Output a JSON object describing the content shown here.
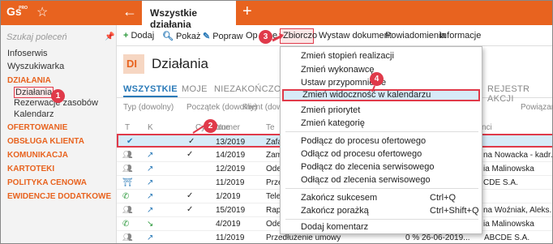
{
  "app": {
    "logo": "Gs",
    "logo_tag": "PRO",
    "tab_title": "Wszystkie działania"
  },
  "sidebar": {
    "search_placeholder": "Szukaj poleceń",
    "items": [
      "Infoserwis",
      "Wyszukiwarka",
      "DZIAŁANIA",
      "Działania",
      "Rezerwacje zasobów",
      "Kalendarz",
      "OFERTOWANIE",
      "OBSŁUGA KLIENTA",
      "KOMUNIKACJA",
      "KARTOTEKI",
      "POLITYKA CENOWA",
      "EWIDENCJE DODATKOWE"
    ]
  },
  "toolbar": {
    "dodaj": "Dodaj",
    "pokaz": "Pokaż",
    "popraw": "Popraw",
    "opcje": "Op",
    "opcje2": "e",
    "zbiorczo": "Zbiorczo",
    "wystaw": "Wystaw dokument",
    "powiadomienia": "Powiadomienia",
    "informacje": "Informacje"
  },
  "page": {
    "badge": "DI",
    "title": "Działania"
  },
  "view_tabs": [
    "WSZYSTKIE",
    "MOJE",
    "NIEZAKOŃCZONE",
    "REJESTR AKCJI"
  ],
  "filters": [
    "Typ (dowolny)",
    "Początek (dowolny)",
    "Klient (dow",
    "Powiązan"
  ],
  "columns": [
    "T",
    "K",
    "Cykliczne",
    "Numer",
    "Te",
    "nci"
  ],
  "rows": [
    {
      "numer": "13/2019",
      "temat": "Zafa",
      "kontakt": "",
      "cykl": "✓"
    },
    {
      "numer": "14/2019",
      "temat": "Zam",
      "kontakt": "na Nowacka - kadr...",
      "cykl": "✓"
    },
    {
      "numer": "12/2019",
      "temat": "Ode",
      "kontakt": "ia Malinowska",
      "cykl": ""
    },
    {
      "numer": "11/2019",
      "temat": "Prze",
      "kontakt": "CDE S.A.",
      "cykl": ""
    },
    {
      "numer": "1/2019",
      "temat": "Tele",
      "kontakt": "",
      "cykl": "✓"
    },
    {
      "numer": "15/2019",
      "temat": "Rap",
      "kontakt": "na Woźniak, Aleks...",
      "cykl": "✓"
    },
    {
      "numer": "4/2019",
      "temat": "Ode",
      "kontakt": "ia Malinowska",
      "cykl": ""
    },
    {
      "numer": "11/2019",
      "temat": "Przedłużenie umowy",
      "kontakt": "ABCDE S.A.",
      "extra": "0 %  26-06-2019...",
      "cykl": ""
    }
  ],
  "menu": {
    "items": [
      "Zmień stopień realizacji",
      "Zmień wykonawcę",
      "Ustaw przypomnienie",
      "Zmień widoczność w kalendarzu",
      "Zmień priorytet",
      "Zmień kategorię",
      "Podłącz do procesu ofertowego",
      "Odłącz od procesu ofertowego",
      "Podłącz do zlecenia serwisowego",
      "Odłącz od zlecenia serwisowego",
      "Zakończ sukcesem",
      "Zakończ porażką",
      "Dodaj komentarz"
    ],
    "shortcuts": {
      "sukces": "Ctrl+Q",
      "porazka": "Ctrl+Shift+Q"
    }
  },
  "steps": [
    "1",
    "2",
    "3",
    "4"
  ],
  "colors": {
    "accent": "#e8631f",
    "highlight": "#e03a4a",
    "selection": "#d7ebf8",
    "link": "#2a7ab8"
  }
}
